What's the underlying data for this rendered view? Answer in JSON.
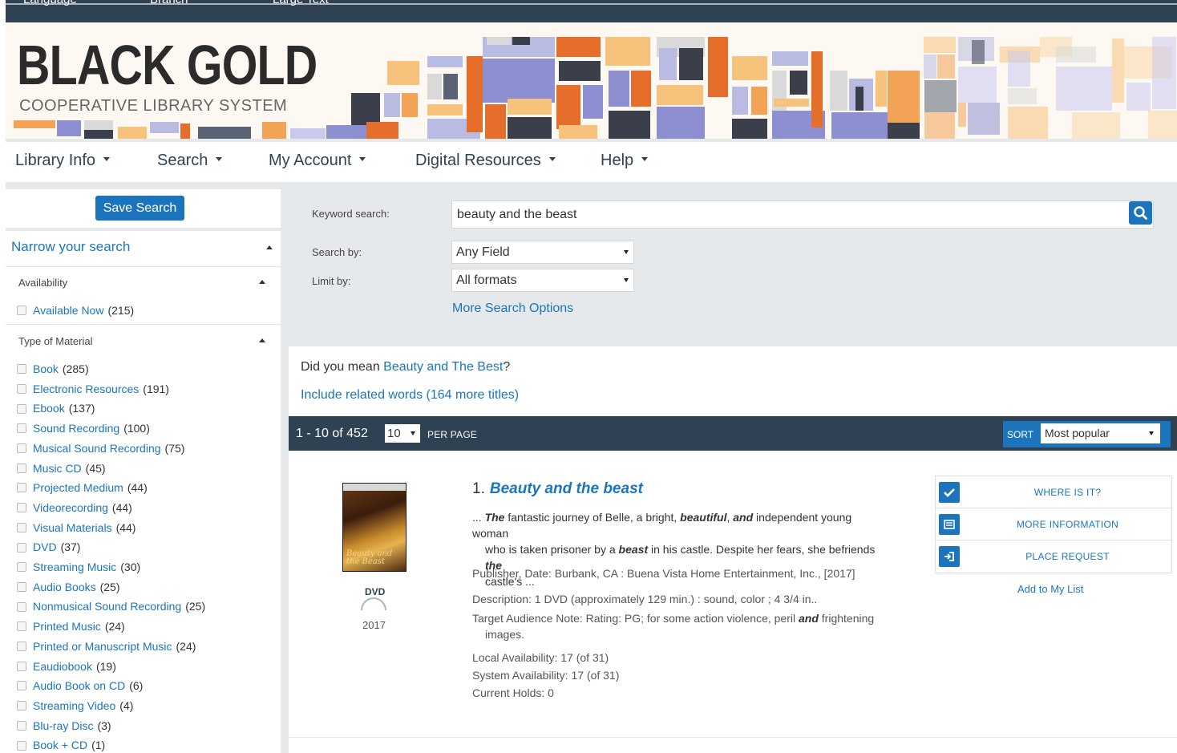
{
  "topbar": {
    "items": [
      "Language",
      "Branch",
      "Large Text"
    ]
  },
  "banner": {
    "title": "BLACK GOLD",
    "subtitle": "COOPERATIVE LIBRARY SYSTEM"
  },
  "nav": {
    "items": [
      {
        "label": "Library Info"
      },
      {
        "label": "Search"
      },
      {
        "label": "My Account"
      },
      {
        "label": "Digital Resources"
      },
      {
        "label": "Help"
      }
    ]
  },
  "sidebar": {
    "save_search": "Save Search",
    "narrow": "Narrow your search",
    "availability_heading": "Availability",
    "availability": [
      {
        "label": "Available Now",
        "count": "(215)"
      }
    ],
    "material_heading": "Type of Material",
    "materials": [
      {
        "label": "Book",
        "count": "(285)"
      },
      {
        "label": "Electronic Resources",
        "count": "(191)"
      },
      {
        "label": "Ebook",
        "count": "(137)"
      },
      {
        "label": "Sound Recording",
        "count": "(100)"
      },
      {
        "label": "Musical Sound Recording",
        "count": "(75)"
      },
      {
        "label": "Music CD",
        "count": "(45)"
      },
      {
        "label": "Projected Medium",
        "count": "(44)"
      },
      {
        "label": "Videorecording",
        "count": "(44)"
      },
      {
        "label": "Visual Materials",
        "count": "(44)"
      },
      {
        "label": "DVD",
        "count": "(37)"
      },
      {
        "label": "Streaming Music",
        "count": "(30)"
      },
      {
        "label": "Audio Books",
        "count": "(25)"
      },
      {
        "label": "Nonmusical Sound Recording",
        "count": "(25)"
      },
      {
        "label": "Printed Music",
        "count": "(24)"
      },
      {
        "label": "Printed or Manuscript Music",
        "count": "(24)"
      },
      {
        "label": "Eaudiobook",
        "count": "(19)"
      },
      {
        "label": "Audio Book on CD",
        "count": "(6)"
      },
      {
        "label": "Streaming Video",
        "count": "(4)"
      },
      {
        "label": "Blu-ray Disc",
        "count": "(3)"
      },
      {
        "label": "Book + CD",
        "count": "(1)"
      }
    ]
  },
  "search": {
    "keyword_label": "Keyword search:",
    "keyword_value": "beauty and the beast",
    "searchby_label": "Search by:",
    "searchby_value": "Any Field",
    "limitby_label": "Limit by:",
    "limitby_value": "All formats",
    "more_options": "More Search Options",
    "icon": "search-icon"
  },
  "suggest": {
    "did_you_mean": "Did you mean",
    "suggestion": "Beauty and The Best",
    "qmark": "?",
    "related": "Include related words (164 more titles)"
  },
  "results": {
    "count": "1 - 10 of 452",
    "per_page_value": "10",
    "per_page_label": "PER PAGE",
    "sort_label": "SORT",
    "sort_value": "Most popular"
  },
  "item": {
    "number": "1.",
    "title": "Beauty and the beast",
    "cover_text": "Beauty and the Beast",
    "format": "DVD",
    "year": "2017",
    "snippet": {
      "prefix": "...",
      "w1": "The",
      "t1": "fantastic journey of Belle, a bright,",
      "w2": "beautiful",
      "t2": ",",
      "w3": "and",
      "t3": "independent young woman",
      "t4": "who is taken prisoner by a",
      "w4": "beast",
      "t5": "in his castle. Despite her fears, she befriends",
      "w5": "the",
      "t6": "castle's ..."
    },
    "publisher": "Publisher, Date: Burbank, CA : Buena Vista Home Entertainment, Inc., [2017]",
    "description": "Description: 1 DVD (approximately 129 min.) : sound, color ; 4 3/4 in..",
    "audience_a": "Target Audience Note: Rating: PG; for some action violence, peril",
    "audience_and": "and",
    "audience_b": "frightening",
    "audience_c": "images.",
    "local": "Local Availability: 17 (of 31)",
    "system": "System Availability: 17 (of 31)",
    "holds": "Current Holds: 0",
    "actions": {
      "where": "WHERE IS IT?",
      "info": "MORE INFORMATION",
      "request": "PLACE REQUEST"
    },
    "add_list": "Add to My List"
  }
}
